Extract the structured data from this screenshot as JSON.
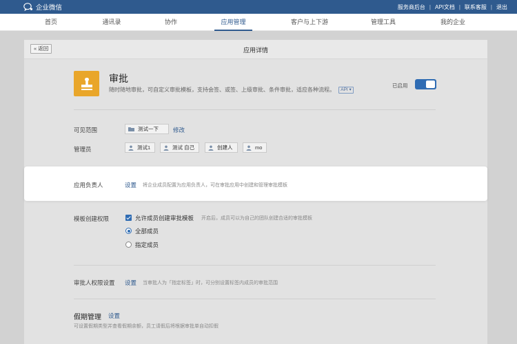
{
  "topbar": {
    "logo_text": "企业微信",
    "links": [
      "服务商后台",
      "API文档",
      "联系客服",
      "退出"
    ],
    "separator": "|",
    "bg_color": "#2f5a8e"
  },
  "nav": {
    "tabs": [
      "首页",
      "通讯录",
      "协作",
      "应用管理",
      "客户与上下游",
      "管理工具",
      "我的企业"
    ],
    "active_index": 3
  },
  "page": {
    "back_label": "« 返回",
    "title": "应用详情"
  },
  "app": {
    "icon": "stamp-icon",
    "icon_color": "#e9a62a",
    "name": "审批",
    "description": "随时随地审批，可自定义审批模板，支持会签、或签、上级审批、条件审批，适应各种流程。",
    "api_tag": "API ▾",
    "status_label": "已启用",
    "enabled": true,
    "accent_color": "#2f6cb3"
  },
  "visibility": {
    "label": "可见范围",
    "scope": "测试一下",
    "edit_link": "修改"
  },
  "admins": {
    "label": "管理员",
    "members": [
      "测试1",
      "测试 自己",
      "创建人",
      "mo"
    ]
  },
  "owner": {
    "label": "应用负责人",
    "action": "设置",
    "hint": "将企业成员配置为应用负责人，可在审批应用中创建和管理审批模板"
  },
  "template_permission": {
    "label": "模板创建权限",
    "checkbox_label": "允许成员创建审批模板",
    "checkbox_checked": true,
    "checkbox_hint": "开启后，成员可以为自己的团队创建合适的审批模板",
    "options": [
      "全部成员",
      "指定成员"
    ],
    "selected_option": 0
  },
  "approver_permission": {
    "label": "审批人权限设置",
    "action": "设置",
    "hint": "当审批人为「指定标签」时，可分别设置标签内成员的审批范围"
  },
  "leave": {
    "title": "假期管理",
    "action": "设置",
    "hint": "可设置假期类型并查看假期余额，员工请假后将根据审批单自动扣假"
  }
}
